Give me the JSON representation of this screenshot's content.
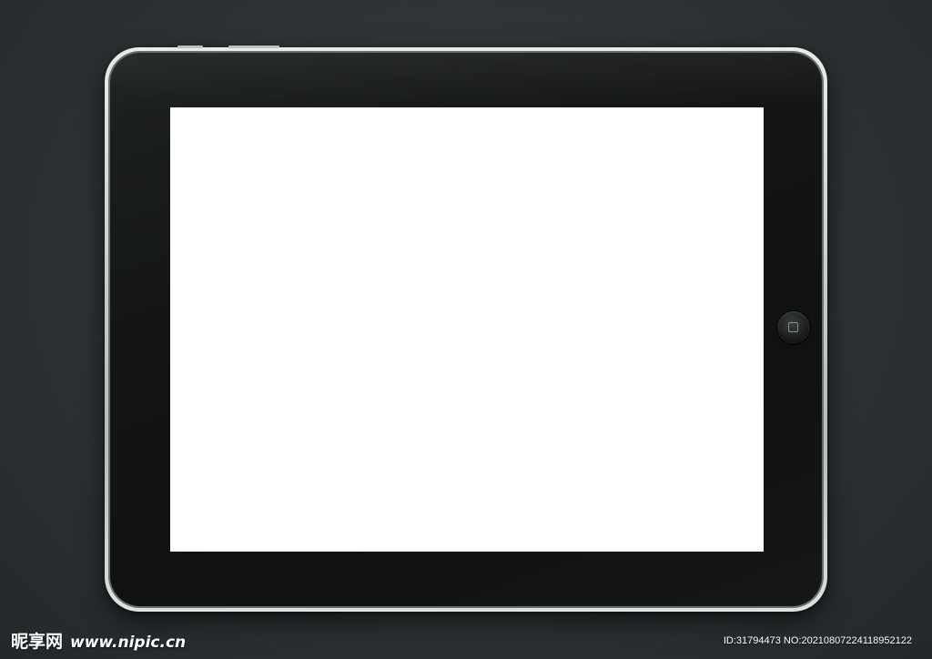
{
  "watermark": {
    "site_name": "昵享网",
    "site_url": "www.nipic.cn",
    "image_id": "ID:31794473 NO:20210807224118952122"
  }
}
